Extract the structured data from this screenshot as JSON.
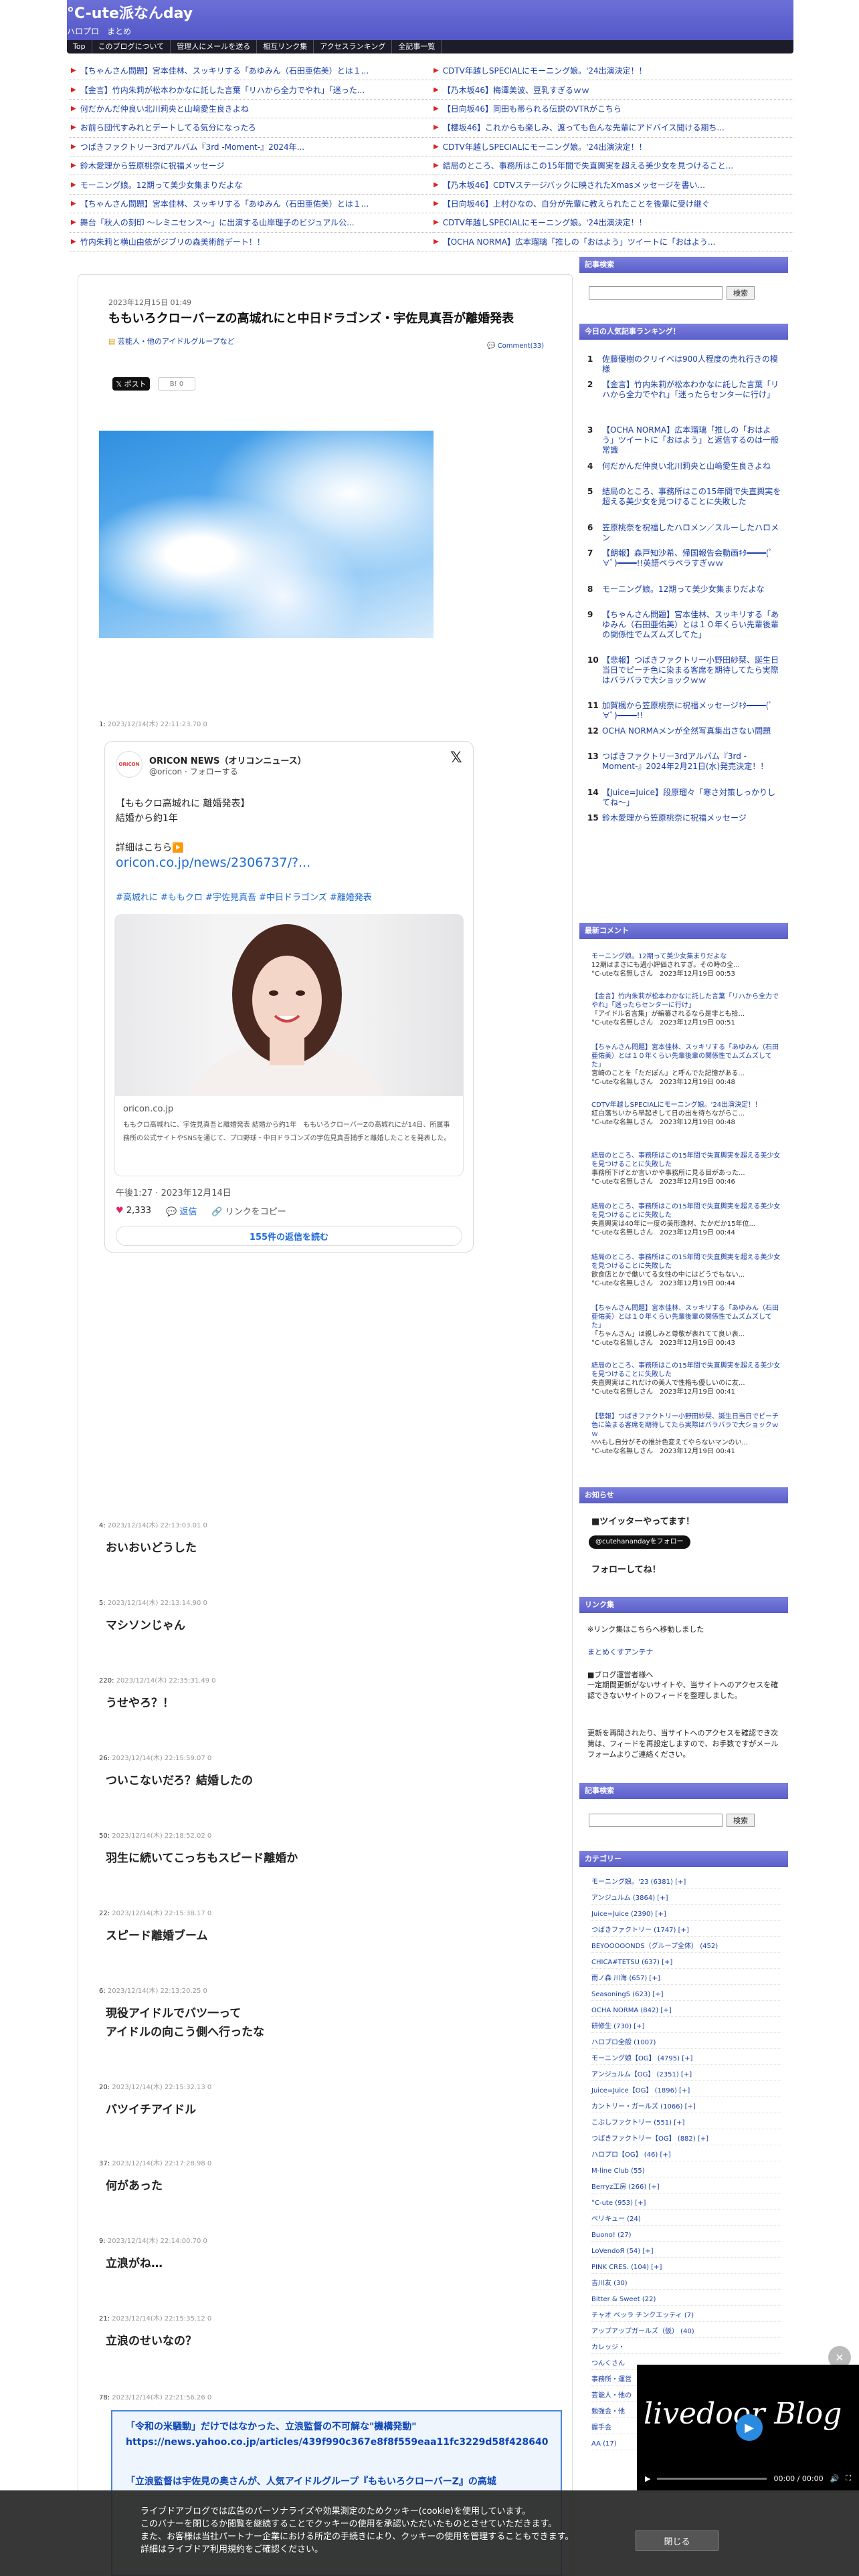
{
  "header": {
    "title": "°C-ute派なんday",
    "subtitle": "ハロプロ　まとめ",
    "nav": [
      "Top",
      "このブログについて",
      "管理人にメールを送る",
      "相互リンク集",
      "アクセスランキング",
      "全記事一覧"
    ]
  },
  "headlines_left": [
    "【ちゃんさん問題】宮本佳林、スッキリする「あゆみん（石田亜佑美）とは１...",
    "【金言】竹内朱莉が松本わかなに託した言葉「リハから全力でやれ」「迷った...",
    "何だかんだ仲良い北川莉央と山﨑愛生良きよね",
    "お前ら団代すみれとデートしてる気分になったろ",
    "つばきファクトリー3rdアルバム『3rd -Moment-』2024年...",
    "鈴木愛理から笠原桃奈に祝福メッセージ",
    "モーニング娘。12期って美少女集まりだよな",
    "【ちゃんさん問題】宮本佳林、スッキリする「あゆみん（石田亜佑美）とは１...",
    "舞台「秋人の刻印 ～レミニセンス～」に出演する山岸理子のビジュアル公...",
    "竹内朱莉と横山由依がジブリの森美術館デート！！"
  ],
  "headlines_right": [
    "CDTV年越しSPECIALにモーニング娘。'24出演決定！！",
    "【乃木坂46】梅澤美波、豆乳すぎるｗｗ",
    "【日向坂46】同田も帯られる伝説のVTRがこちら",
    "【櫻坂46】これからも楽しみ、渡っても色んな先輩にアドバイス聞ける期ち...",
    "CDTV年越しSPECIALにモーニング娘。'24出演決定！！",
    "結局のところ、事務所はこの15年間で失直輿実を超える美少女を見つけること...",
    "【乃木坂46】CDTVステージバックに映されたXmasメッセージを書い...",
    "【日向坂46】上村ひなの、自分が先輩に教えられたことを後輩に受け継ぐ",
    "CDTV年越しSPECIALにモーニング娘。'24出演決定！！",
    "【OCHA NORMA】広本瑠璃「推しの「おはよう」ツイートに「おはよう..."
  ],
  "post": {
    "date": "2023年12月15日 01:49",
    "title": "ももいろクローバーZの高城れにと中日ドラゴンズ・宇佐見真吾が離婚発表",
    "category": "芸能人・他のアイドルグループなど",
    "comments_link": "Comment(33)",
    "share_x": "ポスト",
    "share_b": "0",
    "first_res": {
      "num": "1:",
      "date": "2023/12/14(木) 22:11:23.70 0"
    }
  },
  "tweet": {
    "name": "ORICON NEWS（オリコンニュース）",
    "handle": "@oricon · フォローする",
    "avatar_text": "ORICON",
    "line1": "【ももクロ高城れに 離婚発表】",
    "line2": "結婚から約1年",
    "line3": "詳細はこちら▶️",
    "link": "oricon.co.jp/news/2306737/?...",
    "tags": "#高城れに #ももクロ #宇佐見真吾 #中日ドラゴンズ #離婚発表",
    "domain": "oricon.co.jp",
    "desc": "ももクロ高城れに、宇佐見真吾と離婚発表 結婚から約1年　ももいろクローバーZの高城れにが14日、所属事務所の公式サイトやSNSを通じて、プロ野球・中日ドラゴンズの宇佐見真吾捕手と離婚したことを発表した。",
    "time": "午後1:27 · 2023年12月14日",
    "likes": "2,333",
    "reply": "返信",
    "copy": "リンクをコピー",
    "reply_button": "155件の返信を読む"
  },
  "responses": [
    {
      "num": "4:",
      "date": "2023/12/14(木) 22:13:03.01 0",
      "body": "おいおいどうした"
    },
    {
      "num": "5:",
      "date": "2023/12/14(木) 22:13:14.90 0",
      "body": "マシソンじゃん"
    },
    {
      "num": "220:",
      "date": "2023/12/14(木) 22:35:31.49 0",
      "body": "うせやろ？！"
    },
    {
      "num": "26:",
      "date": "2023/12/14(木) 22:15:59.07 0",
      "body": "ついこないだろ？結婚したの"
    },
    {
      "num": "50:",
      "date": "2023/12/14(木) 22:18:52.02 0",
      "body": "羽生に続いてこっちもスピード離婚か"
    },
    {
      "num": "22:",
      "date": "2023/12/14(木) 22:15:38.17 0",
      "body": "スピード離婚ブーム"
    },
    {
      "num": "6:",
      "date": "2023/12/14(木) 22:13:20.25 0",
      "body": "現役アイドルでバツ一って\nアイドルの向こう側へ行ったな"
    },
    {
      "num": "20:",
      "date": "2023/12/14(木) 22:15:32.13 0",
      "body": "バツイチアイドル"
    },
    {
      "num": "37:",
      "date": "2023/12/14(木) 22:17:28.98 0",
      "body": "何があった"
    },
    {
      "num": "9:",
      "date": "2023/12/14(木) 22:14:00.70 0",
      "body": "立浪がね…"
    },
    {
      "num": "21:",
      "date": "2023/12/14(木) 22:15:35.12 0",
      "body": "立浪のせいなの？"
    },
    {
      "num": "78:",
      "date": "2023/12/14(木) 22:21:56.26 0",
      "body": ""
    }
  ],
  "news": {
    "line1": "「令和の米騒動」だけではなかった、立浪監督の不可解な\"機構発動\"",
    "line2": "https://news.yahoo.co.jp/articles/439f990c367e8f8f559eaa11fc3229d58f428640",
    "line3": "「立浪監督は宇佐見の奥さんが、人気アイドルグループ『ももいろクローバーZ』の高城"
  },
  "sidebar": {
    "search_head": "記事検索",
    "search_btn": "検索",
    "rank_head": "今日の人気記事ランキング！",
    "ranking": [
      "佐藤優樹のクリイベは900人程度の売れ行きの模様",
      "【金言】竹内朱莉が松本わかなに託した言葉「リハから全力でやれ」「迷ったらセンターに行け」",
      "【OCHA NORMA】広本瑠璃「推しの「おはよう」ツイートに「おはよう」と返信するのは一般常識",
      "何だかんだ仲良い北川莉央と山﨑愛生良きよね",
      "結局のところ、事務所はこの15年間で失直輿実を超える美少女を見つけることに失敗した",
      "笠原桃奈を祝福したハロメン／スルーしたハロメン",
      "【朗報】森戸知沙希、帰国報告会動画ｷﾀ━━━━(ﾟ∀ﾟ)━━━━!!英語ペラペラすぎｗｗ",
      "モーニング娘。12期って美少女集まりだよな",
      "【ちゃんさん問題】宮本佳林、スッキリする「あゆみん（石田亜佑美）とは１０年くらい先輩後輩の関係性でムズムズしてた」",
      "【悲報】つばきファクトリー小野田紗栞、誕生日当日でピーチ色に染まる客席を期待してたら実際はバラバラで大ショックｗｗ",
      "加賀楓から笠原桃奈に祝福メッセージｷﾀ━━━━(ﾟ∀ﾟ)━━━━!!",
      "OCHA NORMAメンが全然写真集出さない問題",
      "つばきファクトリー3rdアルバム『3rd -Moment-』2024年2月21日(水)発売決定！！",
      "【Juice=Juice】段原瑠々「寒さ対策しっかりしてね〜」",
      "鈴木愛理から笠原桃奈に祝福メッセージ"
    ],
    "cmt_head": "最新コメント",
    "comments": [
      {
        "title": "モーニング娘。12期って美少女集まりだよな",
        "text": "12期はまさにも過小評価されすぎ。その時の全...",
        "meta": "°C-uteな名無しさん　2023年12月19日 00:53"
      },
      {
        "title": "【金言】竹内朱莉が松本わかなに託した言葉「リハから全力でやれ」「迷ったらセンターに行け」",
        "text": "「アイドル名言集」が編纂されるなら是非とも拾...",
        "meta": "°C-uteな名無しさん　2023年12月19日 00:51"
      },
      {
        "title": "【ちゃんさん問題】宮本佳林、スッキリする「あゆみん（石田亜佑美）とは１０年くらい先輩後輩の関係性でムズムズしてた」",
        "text": "宮崎のことを「ただぽん」と呼んでた記憶がある...",
        "meta": "°C-uteな名無しさん　2023年12月19日 00:48"
      },
      {
        "title": "CDTV年越しSPECIALにモーニング娘。'24出演決定！！",
        "text": "紅白落ちいから早起きして日の出を待ちながらこ...",
        "meta": "°C-uteな名無しさん　2023年12月19日 00:48"
      },
      {
        "title": "結局のところ、事務所はこの15年間で失直輿実を超える美少女を見つけることに失敗した",
        "text": "事務所下げとか言いかや事務所に見る目があった...",
        "meta": "°C-uteな名無しさん　2023年12月19日 00:46"
      },
      {
        "title": "結局のところ、事務所はこの15年間で失直輿実を超える美少女を見つけることに失敗した",
        "text": "失直輿実は40年に一度の美形逸材、たかだか15年位...",
        "meta": "°C-uteな名無しさん　2023年12月19日 00:44"
      },
      {
        "title": "結局のところ、事務所はこの15年間で失直輿実を超える美少女を見つけることに失敗した",
        "text": "飲食店とかで働いてる女性の中にはどうでもない...",
        "meta": "°C-uteな名無しさん　2023年12月19日 00:44"
      },
      {
        "title": "【ちゃんさん問題】宮本佳林、スッキリする「あゆみん（石田亜佑美）とは１０年くらい先輩後輩の関係性でムズムズしてた」",
        "text": "「ちゃんさん」は親しみと尊敬が表れてて良い表...",
        "meta": "°C-uteな名無しさん　2023年12月19日 00:43"
      },
      {
        "title": "結局のところ、事務所はこの15年間で失直輿実を超える美少女を見つけることに失敗した",
        "text": "失直輿実はこれだけの美人で性格も優しいのに友...",
        "meta": "°C-uteな名無しさん　2023年12月19日 00:41"
      },
      {
        "title": "【悲報】つばきファクトリー小野田紗栞、誕生日当日でピーチ色に染まる客席を期待してたら実際はバラバラで大ショックｗｗ",
        "text": "ﾍﾍﾍもし自分がその推計色変えてやらないマンのい...",
        "meta": "°C-uteな名無しさん　2023年12月19日 00:41"
      }
    ],
    "notice_head": "お知らせ",
    "notice_twitter": "■ツイッターやってます！",
    "follow_btn": "@cutehanandayをフォロー",
    "follow_text": "フォローしてね！",
    "link_head": "リンク集",
    "link_note": "※リンク集はこちらへ移動しました",
    "link_antenna": "まとめくすアンテナ",
    "policy_title": "■ブログ運営者様へ",
    "policy_text": "一定期間更新がないサイトや、当サイトへのアクセスを確認できないサイトのフィードを整理しました。",
    "policy_text2": "更新を再開されたり、当サイトへのアクセスを確認でき次第は、フィードを再設定しますので、お手数ですがメールフォームよりご連絡ください。",
    "search_head2": "記事検索",
    "cat_head": "カテゴリー",
    "categories": [
      "モーニング娘。'23 (6381) [+]",
      "アンジュルム (3864) [+]",
      "Juice=Juice (2390) [+]",
      "つばきファクトリー (1747) [+]",
      "BEYOOOOONDS（グループ全体） (452)",
      "CHICA#TETSU (637) [+]",
      "雨ノ森 川海 (657) [+]",
      "SeasoningS (623) [+]",
      "OCHA NORMA (842) [+]",
      "研修生 (730) [+]",
      "ハロプロ全般 (1007)",
      "モーニング娘【OG】 (4795) [+]",
      "アンジュルム【OG】 (2351) [+]",
      "Juice=Juice【OG】 (1896) [+]",
      "カントリー・ガールズ (1066) [+]",
      "こぶしファクトリー (551) [+]",
      "つばきファクトリー【OG】 (882) [+]",
      "ハロプロ【OG】 (46) [+]",
      "M-line Club (55)",
      "Berryz工房 (266) [+]",
      "°C-ute (953) [+]",
      "ベリキュー (24)",
      "Buono! (27)",
      "LoVendoЯ (54) [+]",
      "PINK CRES. (104) [+]",
      "吉川友 (30)",
      "Bitter & Sweet (22)",
      "チャオ ベッラ チンクエッティ (7)",
      "アップアップガールズ（仮） (40)",
      "カレッジ・",
      "つんくさん",
      "事務所・運営",
      "芸能人・他の",
      "勉強会・他",
      "握手会",
      "AA (17)"
    ]
  },
  "video": {
    "logo": "livedoor Blog",
    "time": "00:00 / 00:00"
  },
  "cookie": {
    "line1": "ライブドアブログでは広告のパーソナライズや効果測定のためクッキー(cookie)を使用しています。",
    "line2": "このバナーを閉じるか閲覧を継続することでクッキーの使用を承認いただいたものとさせていただきます。",
    "line3": "また、お客様は当社パートナー企業における所定の手続きにより、クッキーの使用を管理することもできます。",
    "line4": "詳細はライブドア利用規約をご確認ください。",
    "close": "閉じる"
  }
}
